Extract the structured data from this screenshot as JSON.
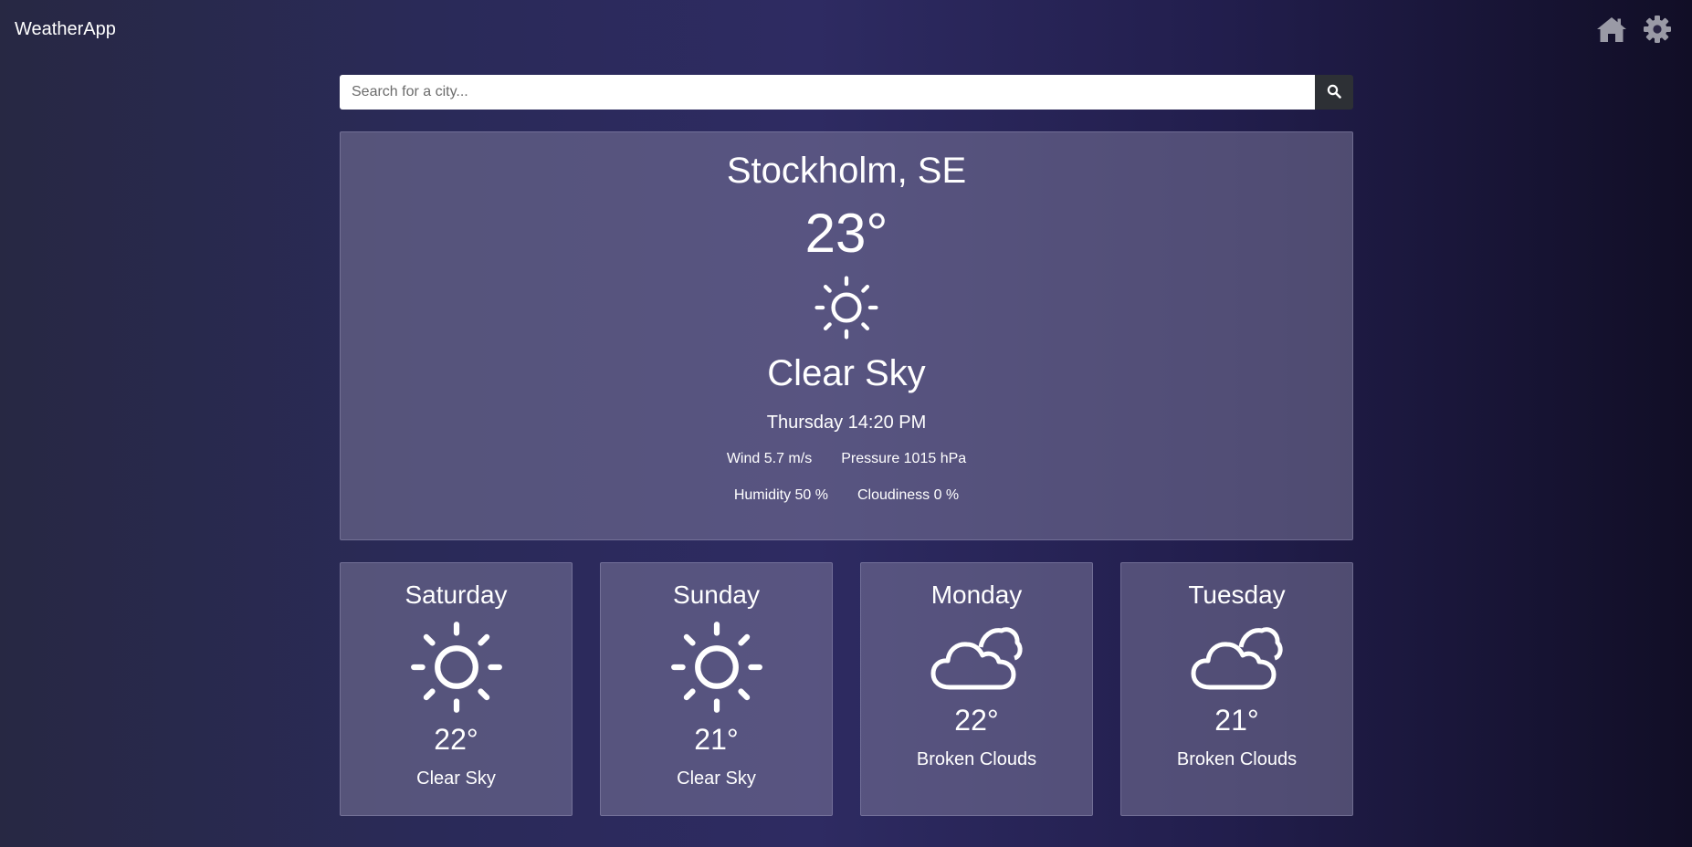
{
  "app": {
    "brand": "WeatherApp"
  },
  "nav": {
    "home_icon": "home-icon",
    "settings_icon": "gear-icon",
    "icon_color": "#9a9aa6"
  },
  "search": {
    "placeholder": "Search for a city...",
    "value": "",
    "button_icon": "search-icon"
  },
  "current": {
    "city": "Stockholm, SE",
    "temperature": "23°",
    "icon": "sun-icon",
    "description": "Clear Sky",
    "datetime": "Thursday 14:20 PM",
    "wind": "Wind 5.7 m/s",
    "pressure": "Pressure 1015 hPa",
    "humidity": "Humidity 50 %",
    "cloudiness": "Cloudiness 0 %"
  },
  "forecast": [
    {
      "day": "Saturday",
      "icon": "sun-icon",
      "temperature": "22°",
      "description": "Clear Sky"
    },
    {
      "day": "Sunday",
      "icon": "sun-icon",
      "temperature": "21°",
      "description": "Clear Sky"
    },
    {
      "day": "Monday",
      "icon": "cloud-icon",
      "temperature": "22°",
      "description": "Broken Clouds"
    },
    {
      "day": "Tuesday",
      "icon": "cloud-icon",
      "temperature": "21°",
      "description": "Broken Clouds"
    }
  ],
  "colors": {
    "card_background": "#5a5680",
    "search_button": "#2d3035",
    "text": "#ffffff"
  }
}
